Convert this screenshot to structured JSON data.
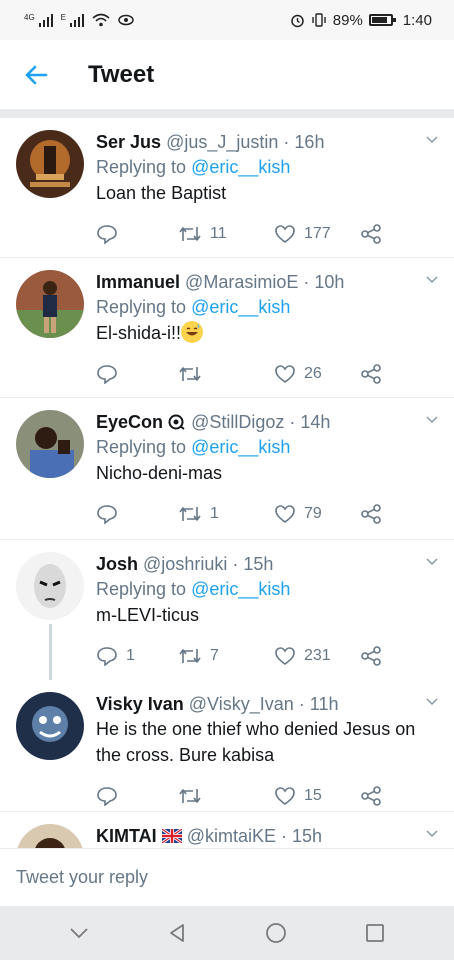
{
  "status_bar": {
    "signal1_label": "4G",
    "signal2_label": "E",
    "battery_text": "89%",
    "time": "1:40"
  },
  "header": {
    "title": "Tweet"
  },
  "replies": [
    {
      "name": "Ser Jus",
      "handle": "@jus_J_justin",
      "time": "16h",
      "replying_prefix": "Replying to",
      "replying_to": "@eric__kish",
      "text": "Loan the Baptist",
      "retweets": "11",
      "likes": "177"
    },
    {
      "name": "Immanuel",
      "handle": "@MarasimioE",
      "time": "10h",
      "replying_prefix": "Replying to",
      "replying_to": "@eric__kish",
      "text": "El-shida-i!!",
      "emoji": "grinning-sweat-emoji",
      "retweets": "",
      "likes": "26"
    },
    {
      "name": "EyeCon",
      "handle": "@StillDigoz",
      "time": "14h",
      "replying_prefix": "Replying to",
      "replying_to": "@eric__kish",
      "text": "Nicho-deni-mas",
      "retweets": "1",
      "likes": "79"
    },
    {
      "name": "Josh",
      "handle": "@joshriuki",
      "time": "15h",
      "replying_prefix": "Replying to",
      "replying_to": "@eric__kish",
      "text": "m-LEVI-ticus",
      "replies": "1",
      "retweets": "7",
      "likes": "231"
    },
    {
      "name": "Visky Ivan",
      "handle": "@Visky_Ivan",
      "time": "11h",
      "text": "He is the one thief who denied Jesus on the cross. Bure kabisa",
      "retweets": "",
      "likes": "15"
    },
    {
      "name": "KIMTAI",
      "flag": "uk-flag-icon",
      "handle": "@kimtaiKE",
      "time": "15h"
    }
  ],
  "reply_bar": {
    "placeholder": "Tweet your reply"
  },
  "colors": {
    "accent": "#1da1f2",
    "muted": "#657786",
    "divider": "#e6ecf0"
  }
}
